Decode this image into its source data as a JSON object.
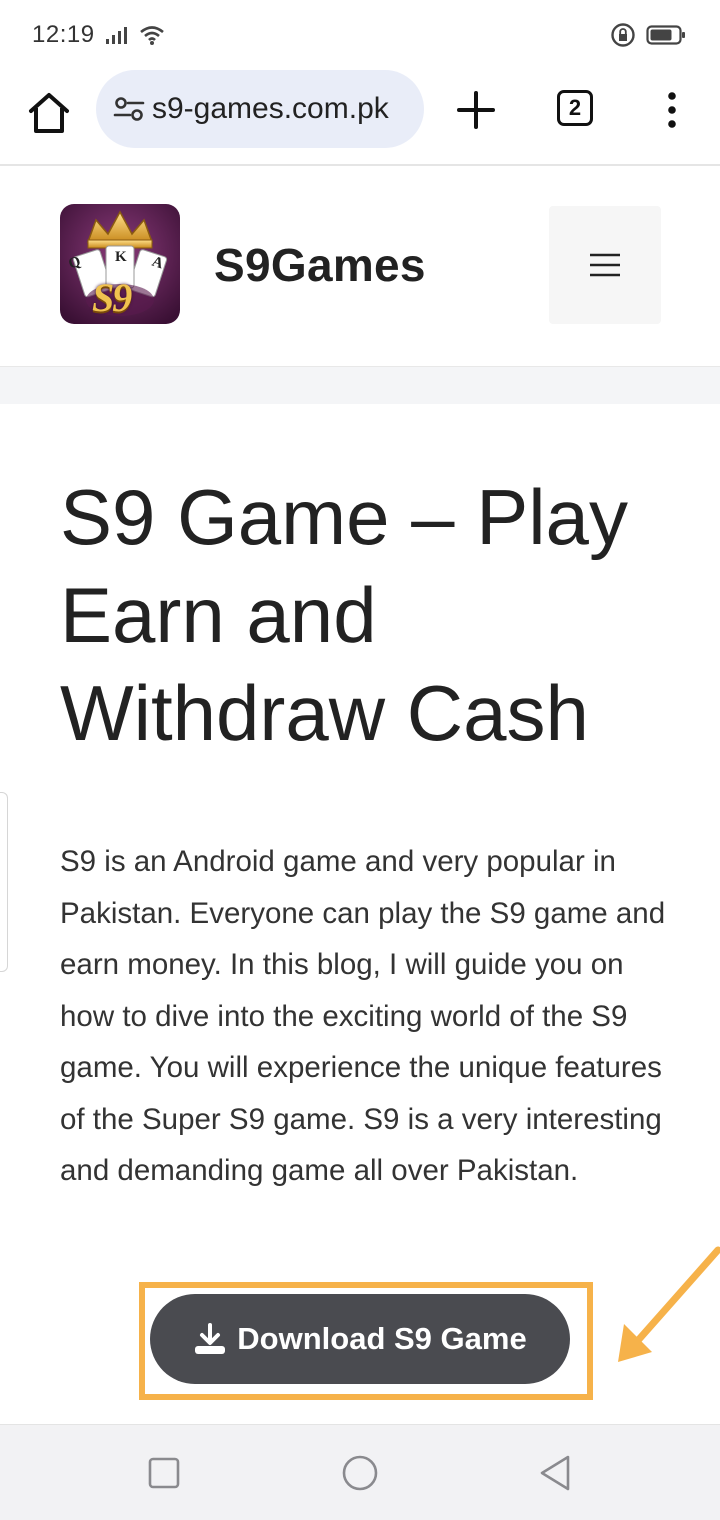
{
  "status": {
    "time": "12:19",
    "icons": [
      "signal-icon",
      "wifi-icon",
      "rotation-lock-icon",
      "battery-icon"
    ]
  },
  "browser": {
    "url": "s9-games.com.pk",
    "tab_count": "2",
    "icons": [
      "home-icon",
      "site-settings-icon",
      "new-tab-plus-icon",
      "tab-switcher-icon",
      "more-menu-icon"
    ]
  },
  "site": {
    "title": "S9Games",
    "logo_letters": [
      "Q",
      "K",
      "A"
    ],
    "logo_mark": "S9"
  },
  "article": {
    "title_lines": [
      "S9 Game – Play",
      "Earn and",
      "Withdraw Cash"
    ],
    "body": "S9 is an Android game and very popular in Pakistan. Everyone can play the S9 game and earn money. In this blog, I will guide you on how to dive into the exciting world of the S9 game. You will experience the unique features of the Super S9 game. S9 is a very interesting and demanding game all over Pakistan."
  },
  "cta": {
    "label": "Download S9 Game",
    "icon": "download-icon"
  },
  "colors": {
    "url_pill": "#e9edf8",
    "button_bg": "#4a4b50",
    "highlight": "#f6b24a",
    "logo_bg": "#4b1a45",
    "logo_gold": "#e7b13e"
  }
}
